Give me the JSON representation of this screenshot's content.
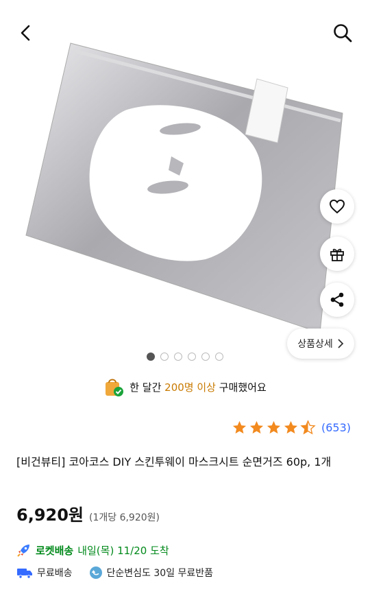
{
  "header": {
    "back_icon": "chevron-left-icon",
    "search_icon": "search-icon"
  },
  "gallery": {
    "total_images": 6,
    "active_index": 0
  },
  "side_actions": [
    {
      "name": "like",
      "icon": "heart-icon"
    },
    {
      "name": "gift",
      "icon": "gift-icon"
    },
    {
      "name": "share",
      "icon": "share-icon"
    }
  ],
  "detail_button": {
    "label": "상품상세",
    "icon": "chevron-right-icon"
  },
  "purchase_info": {
    "prefix": "한 달간 ",
    "highlight": "200명 이상",
    "suffix": " 구매했어요"
  },
  "rating": {
    "stars": 4.5,
    "review_count": "(653)"
  },
  "product": {
    "title": "[비건뷰티] 코아코스 DIY 스킨투웨이 마스크시트 순면거즈 60p, 1개",
    "price": "6,920원",
    "unit_price": "(1개당 6,920원)"
  },
  "delivery": {
    "brand": "로켓배송",
    "arrival": "내일(목) 11/20 도착"
  },
  "benefits": {
    "shipping": "무료배송",
    "returns": "단순변심도 30일 무료반품"
  },
  "colors": {
    "accent_blue": "#346aff",
    "rocket_green": "#00891a",
    "star": "#f28a1f",
    "highlight": "#c97a00"
  }
}
